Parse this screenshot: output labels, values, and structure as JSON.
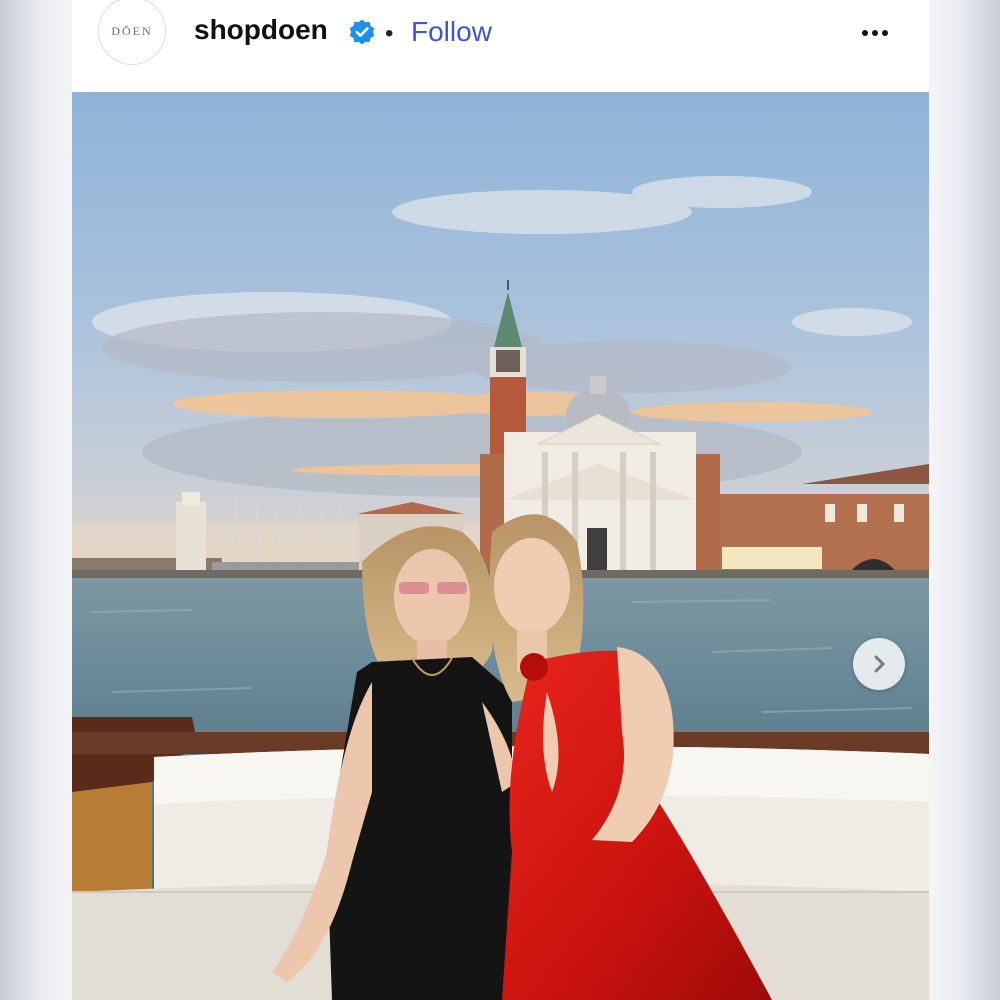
{
  "post": {
    "avatar_text": "DŌEN",
    "username": "shopdoen",
    "verified_icon": "verified-badge-icon",
    "separator": "•",
    "follow_label": "Follow",
    "more_icon": "more-options-icon"
  },
  "media": {
    "description_icon": "photo",
    "next_icon": "chevron-right-icon"
  },
  "colors": {
    "follow": "#3d55d6",
    "verified": "#1d8ff0",
    "sky_top": "#8fb2d6",
    "water": "#4d6f7c",
    "red_dress": "#d2140f"
  }
}
